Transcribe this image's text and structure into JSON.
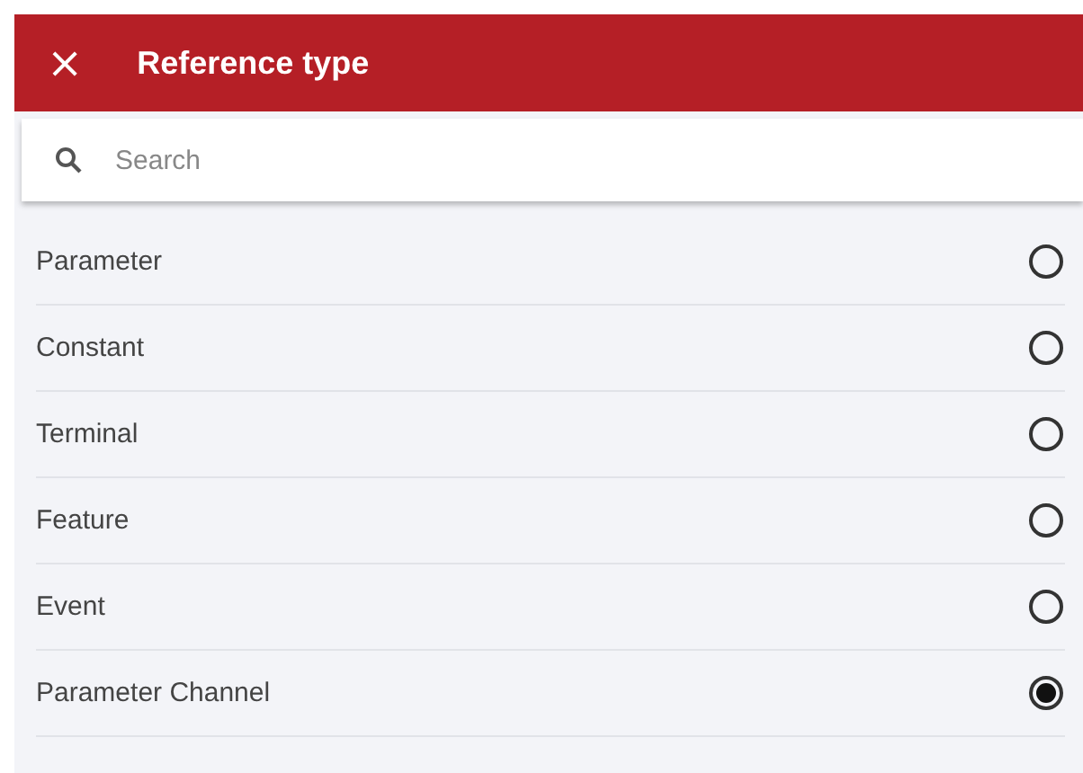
{
  "header": {
    "close": "×",
    "title": "Reference type"
  },
  "search": {
    "placeholder": "Search"
  },
  "options": [
    {
      "label": "Parameter",
      "selected": false
    },
    {
      "label": "Constant",
      "selected": false
    },
    {
      "label": "Terminal",
      "selected": false
    },
    {
      "label": "Feature",
      "selected": false
    },
    {
      "label": "Event",
      "selected": false
    },
    {
      "label": "Parameter Channel",
      "selected": true
    }
  ]
}
